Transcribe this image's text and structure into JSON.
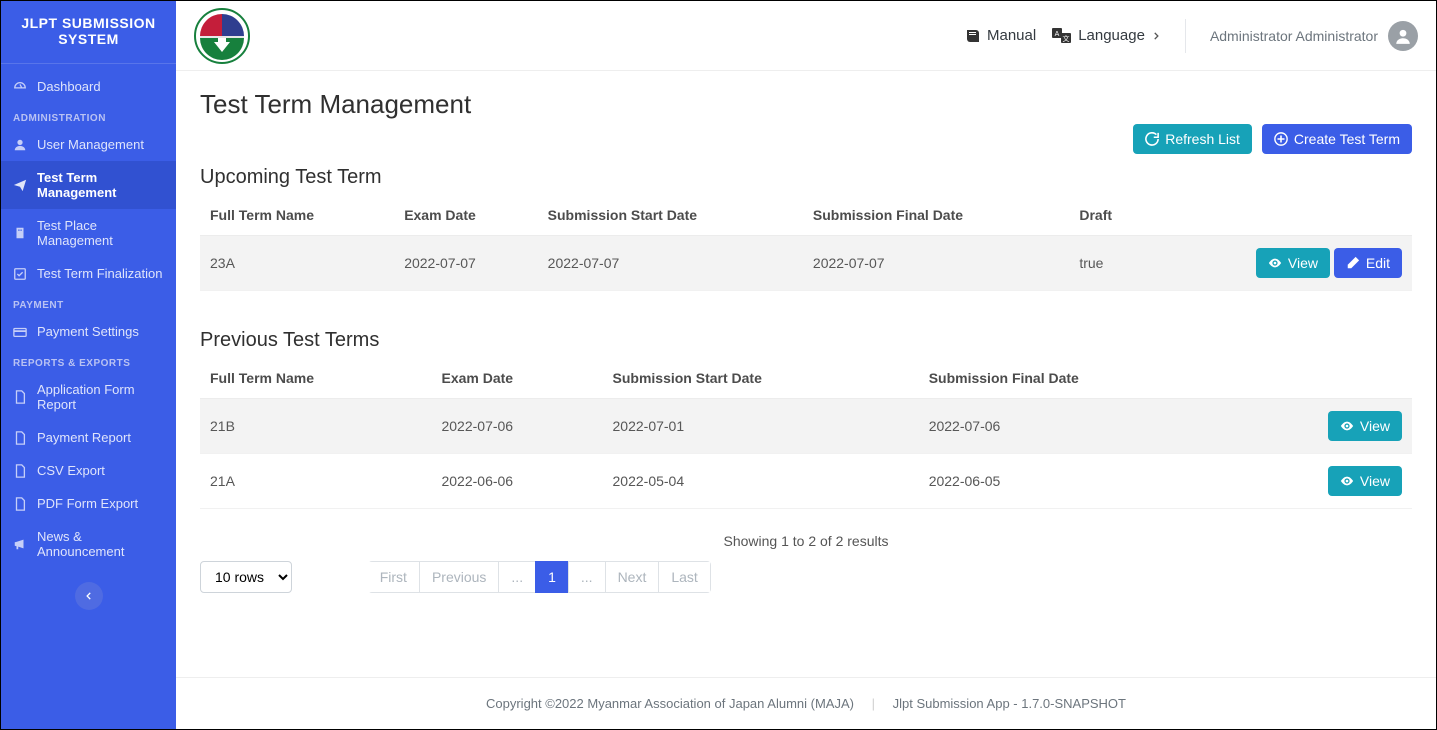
{
  "brand": "JLPT SUBMISSION SYSTEM",
  "sidebar": {
    "sections": [
      {
        "title": "",
        "items": [
          {
            "label": "Dashboard",
            "icon": "tachometer"
          }
        ]
      },
      {
        "title": "ADMINISTRATION",
        "items": [
          {
            "label": "User Management",
            "icon": "user"
          },
          {
            "label": "Test Term Management",
            "icon": "paper-plane",
            "active": true
          },
          {
            "label": "Test Place Management",
            "icon": "building"
          },
          {
            "label": "Test Term Finalization",
            "icon": "check-square"
          }
        ]
      },
      {
        "title": "PAYMENT",
        "items": [
          {
            "label": "Payment Settings",
            "icon": "credit-card"
          }
        ]
      },
      {
        "title": "REPORTS & EXPORTS",
        "items": [
          {
            "label": "Application Form Report",
            "icon": "file"
          },
          {
            "label": "Payment Report",
            "icon": "file"
          },
          {
            "label": "CSV Export",
            "icon": "file"
          },
          {
            "label": "PDF Form Export",
            "icon": "file"
          },
          {
            "label": "News & Announcement",
            "icon": "bullhorn"
          }
        ]
      }
    ]
  },
  "topbar": {
    "manual": "Manual",
    "language": "Language",
    "user": "Administrator Administrator"
  },
  "page": {
    "title": "Test Term Management",
    "refresh": "Refresh List",
    "create": "Create Test Term"
  },
  "upcoming": {
    "heading": "Upcoming Test Term",
    "columns": [
      "Full Term Name",
      "Exam Date",
      "Submission Start Date",
      "Submission Final Date",
      "Draft",
      ""
    ],
    "rows": [
      {
        "name": "23A",
        "exam": "2022-07-07",
        "start": "2022-07-07",
        "final": "2022-07-07",
        "draft": "true"
      }
    ],
    "view": "View",
    "edit": "Edit"
  },
  "previous": {
    "heading": "Previous Test Terms",
    "columns": [
      "Full Term Name",
      "Exam Date",
      "Submission Start Date",
      "Submission Final Date",
      ""
    ],
    "rows": [
      {
        "name": "21B",
        "exam": "2022-07-06",
        "start": "2022-07-01",
        "final": "2022-07-06"
      },
      {
        "name": "21A",
        "exam": "2022-06-06",
        "start": "2022-05-04",
        "final": "2022-06-05"
      }
    ],
    "view": "View"
  },
  "pagination": {
    "rows_label": "10 rows",
    "showing": "Showing 1 to 2 of 2 results",
    "first": "First",
    "previous": "Previous",
    "dots": "...",
    "page": "1",
    "next": "Next",
    "last": "Last"
  },
  "footer": {
    "left": "Copyright ©2022 Myanmar Association of Japan Alumni (MAJA)",
    "right": "Jlpt Submission App - 1.7.0-SNAPSHOT"
  }
}
